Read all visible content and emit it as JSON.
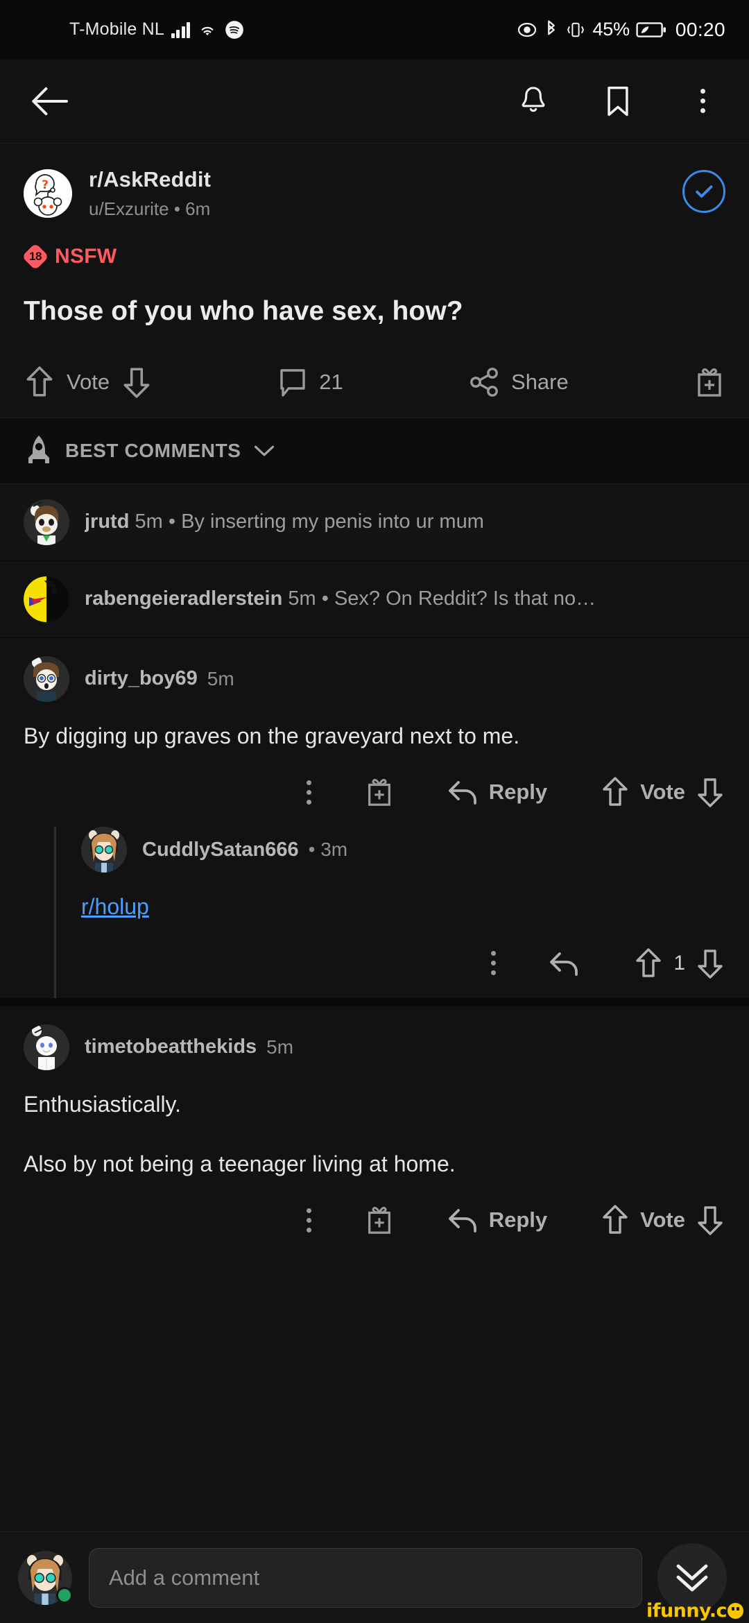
{
  "statusbar": {
    "carrier": "T-Mobile NL",
    "battery_percent": "45%",
    "clock": "00:20",
    "icons": [
      "signal-icon",
      "wifi-icon",
      "spotify-icon",
      "eye-icon",
      "bluetooth-icon",
      "vibrate-icon",
      "battery-icon"
    ]
  },
  "navbar": {
    "back": "back-arrow-icon",
    "notifications": "bell-icon",
    "save": "bookmark-icon",
    "more": "kebab-menu-icon"
  },
  "post": {
    "subreddit": "r/AskReddit",
    "byline": "u/Exzurite • 6m",
    "joined_icon": "check-circle-icon",
    "nsfw_number": "18",
    "nsfw_label": "NSFW",
    "title": "Those of you who have sex, how?",
    "actions": {
      "vote_label": "Vote",
      "comment_count": "21",
      "share_label": "Share",
      "award_icon": "award-gift-icon"
    }
  },
  "sort": {
    "icon": "rocket-icon",
    "label": "BEST COMMENTS",
    "chevron": "chevron-down-icon"
  },
  "collapsed_comments": [
    {
      "author": "jrutd",
      "time": "5m",
      "preview": "By inserting my penis into ur mum"
    },
    {
      "author": "rabengeieradlerstein",
      "time": "5m",
      "preview": "Sex? On Reddit? Is that no…"
    }
  ],
  "comments": [
    {
      "author": "dirty_boy69",
      "time": "5m",
      "body": "By digging up graves on the graveyard next to me.",
      "actions": {
        "more": "kebab-menu-icon",
        "award": "award-gift-icon",
        "reply_label": "Reply",
        "vote_label": "Vote"
      },
      "reply": {
        "author": "CuddlySatan666",
        "time": "• 3m",
        "link": "r/holup",
        "score": "1"
      }
    },
    {
      "author": "timetobeatthekids",
      "time": "5m",
      "body_line_1": "Enthusiastically.",
      "body_line_2": "Also by not being a teenager living at home.",
      "actions": {
        "more": "kebab-menu-icon",
        "award": "award-gift-icon",
        "reply_label": "Reply",
        "vote_label": "Vote"
      }
    }
  ],
  "bottombar": {
    "placeholder": "Add a comment",
    "scroll_icon": "double-chevron-down-icon"
  },
  "watermark": {
    "text": "ifunny.c"
  },
  "colors": {
    "background": "#121212",
    "nsfw": "#ff5a5f",
    "link": "#4a9eff",
    "joined": "#3a8be8",
    "watermark": "#f7c600",
    "online": "#1ea362"
  }
}
